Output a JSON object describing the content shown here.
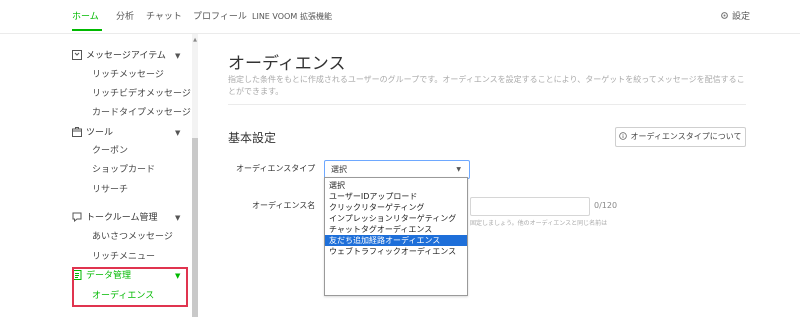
{
  "nav": {
    "tabs": [
      {
        "label": "ホーム",
        "active": true
      },
      {
        "label": "分析",
        "active": false
      },
      {
        "label": "チャット",
        "active": false
      },
      {
        "label": "プロフィール",
        "active": false
      },
      {
        "label": "LINE VOOM",
        "active": false
      },
      {
        "label": "拡張機能",
        "active": false
      }
    ],
    "settings_label": "設定",
    "settings_icon": "gear-icon"
  },
  "sidebar": {
    "items": [
      {
        "label": "メッセージアイテム",
        "type": "category",
        "icon": "message-item-icon",
        "expanded": true
      },
      {
        "label": "リッチメッセージ",
        "type": "sub"
      },
      {
        "label": "リッチビデオメッセージ",
        "type": "sub"
      },
      {
        "label": "カードタイプメッセージ",
        "type": "sub"
      },
      {
        "label": "ツール",
        "type": "category",
        "icon": "tool-icon",
        "expanded": true
      },
      {
        "label": "クーポン",
        "type": "sub"
      },
      {
        "label": "ショップカード",
        "type": "sub"
      },
      {
        "label": "リサーチ",
        "type": "sub"
      },
      {
        "label": "トークルーム管理",
        "type": "category",
        "icon": "chat-room-icon",
        "expanded": true
      },
      {
        "label": "あいさつメッセージ",
        "type": "sub"
      },
      {
        "label": "リッチメニュー",
        "type": "sub"
      },
      {
        "label": "データ管理",
        "type": "category",
        "icon": "data-icon",
        "expanded": true,
        "active": true
      },
      {
        "label": "オーディエンス",
        "type": "sub",
        "active": true
      }
    ]
  },
  "main": {
    "title": "オーディエンス",
    "description": "指定した条件をもとに作成されるユーザーのグループです。オーディエンスを設定することにより、ターゲットを絞ってメッセージを配信することができます。",
    "section_title": "基本設定",
    "about_button": "オーディエンスタイプについて",
    "audience_type_label": "オーディエンスタイプ",
    "audience_type_value": "選択",
    "audience_name_label": "オーディエンス名",
    "name_count": "0/120",
    "name_hint": "固定しましょう。他のオーディエンスと同じ名前は",
    "dropdown_options": [
      {
        "label": "選択",
        "selected": false
      },
      {
        "label": "ユーザーIDアップロード",
        "selected": false
      },
      {
        "label": "クリックリターゲティング",
        "selected": false
      },
      {
        "label": "インプレッションリターゲティング",
        "selected": false
      },
      {
        "label": "チャットタグオーディエンス",
        "selected": false
      },
      {
        "label": "友だち追加経路オーディエンス",
        "selected": true
      },
      {
        "label": "ウェブトラフィックオーディエンス",
        "selected": false
      }
    ]
  },
  "colors": {
    "accent": "#00b900",
    "highlight": "#e0344f",
    "selection": "#1e6fd9"
  }
}
